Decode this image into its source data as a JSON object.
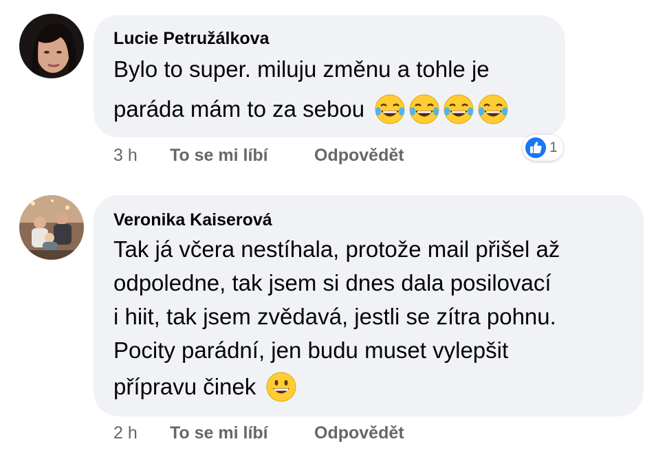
{
  "comments": [
    {
      "author": "Lucie Petružálkova",
      "lines": [
        "Bylo to super. miluju změnu a tohle je",
        "paráda mám to za sebou"
      ],
      "emoji": [
        "laugh-tears-emoji",
        "laugh-tears-emoji",
        "laugh-tears-emoji",
        "laugh-tears-emoji"
      ],
      "time": "3 h",
      "like_label": "To se mi líbí",
      "reply_label": "Odpovědět",
      "reaction_count": "1"
    },
    {
      "author": "Veronika Kaiserová",
      "lines": [
        "Tak já včera nestíhala, protože mail přišel až",
        "odpoledne, tak jsem si dnes dala posilovací",
        "i hiit, tak jsem zvědavá, jestli se zítra pohnu.",
        "Pocity parádní, jen budu muset vylepšit",
        "přípravu činek"
      ],
      "emoji": [
        "smile-emoji"
      ],
      "time": "2 h",
      "like_label": "To se mi líbí",
      "reply_label": "Odpovědět"
    }
  ],
  "colors": {
    "bubble": "#f0f2f5",
    "meta_text": "#65676b",
    "like_blue": "#1877f2",
    "emoji_yellow": "#ffcc33"
  }
}
